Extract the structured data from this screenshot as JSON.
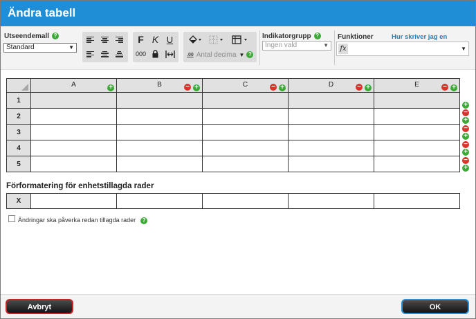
{
  "dialog": {
    "title": "Ändra tabell"
  },
  "toolbar": {
    "style_label": "Utseendemall",
    "style_value": "Standard",
    "help_glyph": "?",
    "bold_label": "F",
    "italic_label": "K",
    "underline_label": "U",
    "number_format_label": "000",
    "decimals_placeholder": "Antal decima",
    "indicator_label": "Indikatorgrupp",
    "indicator_value": "Ingen vald",
    "functions_label": "Funktioner",
    "functions_link": "Hur skriver jag en funktion?",
    "fx_label": "fx"
  },
  "grid": {
    "columns": [
      "A",
      "B",
      "C",
      "D",
      "E"
    ],
    "rows": [
      "1",
      "2",
      "3",
      "4",
      "5"
    ]
  },
  "preformat": {
    "title": "Förformatering för enhetstillagda rader",
    "row_label": "X",
    "checkbox_label": "Ändringar ska påverka redan tillagda rader"
  },
  "footer": {
    "cancel_label": "Avbryt",
    "ok_label": "OK"
  },
  "colors": {
    "titlebar": "#1f8ed6",
    "add": "#3aaa35",
    "remove": "#d9342b",
    "cancel_border": "#c8232c",
    "ok_border": "#2a8fd6"
  }
}
